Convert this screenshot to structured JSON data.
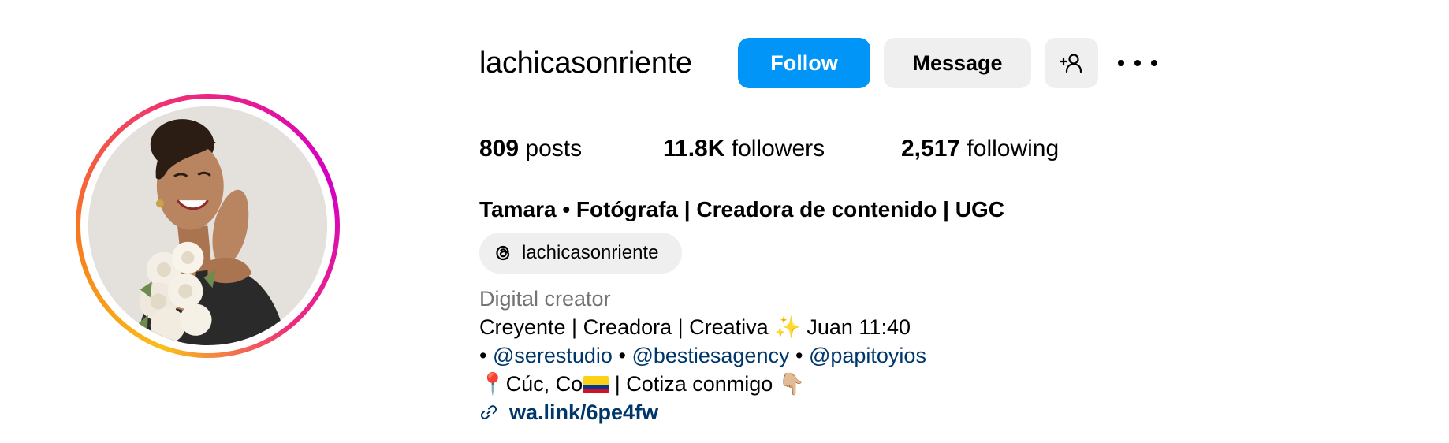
{
  "profile": {
    "username": "lachicasonriente",
    "full_name": "Tamara • Fotógrafa | Creadora de contenido | UGC",
    "avatar_alt": "profile-photo"
  },
  "actions": {
    "follow_label": "Follow",
    "message_label": "Message",
    "add_user_icon": "person-add-icon",
    "more_icon": "more-options-icon"
  },
  "stats": {
    "posts_count": "809",
    "posts_label": "posts",
    "followers_count": "11.8K",
    "followers_label": "followers",
    "following_count": "2,517",
    "following_label": "following"
  },
  "threads": {
    "icon": "threads-icon",
    "label": "lachicasonriente"
  },
  "bio": {
    "category": "Digital creator",
    "line1_text": "Creyente | Creadora | Creativa",
    "line1_emoji": "✨",
    "line1_suffix": "Juan 11:40",
    "bullet": "•",
    "mentions": [
      "@serestudio",
      "@bestiesagency",
      "@papitoyios"
    ],
    "line3_pin": "📍",
    "line3_location": "Cúc, Co",
    "line3_flag": "colombia-flag",
    "line3_text": "| Cotiza conmigo",
    "line3_emoji": "👇🏼",
    "website_icon": "link-icon",
    "website": "wa.link/6pe4fw"
  },
  "colors": {
    "follow_button": "#0095f6",
    "secondary_button": "#efefef",
    "mention_link": "#00376b",
    "muted_text": "#737373"
  }
}
